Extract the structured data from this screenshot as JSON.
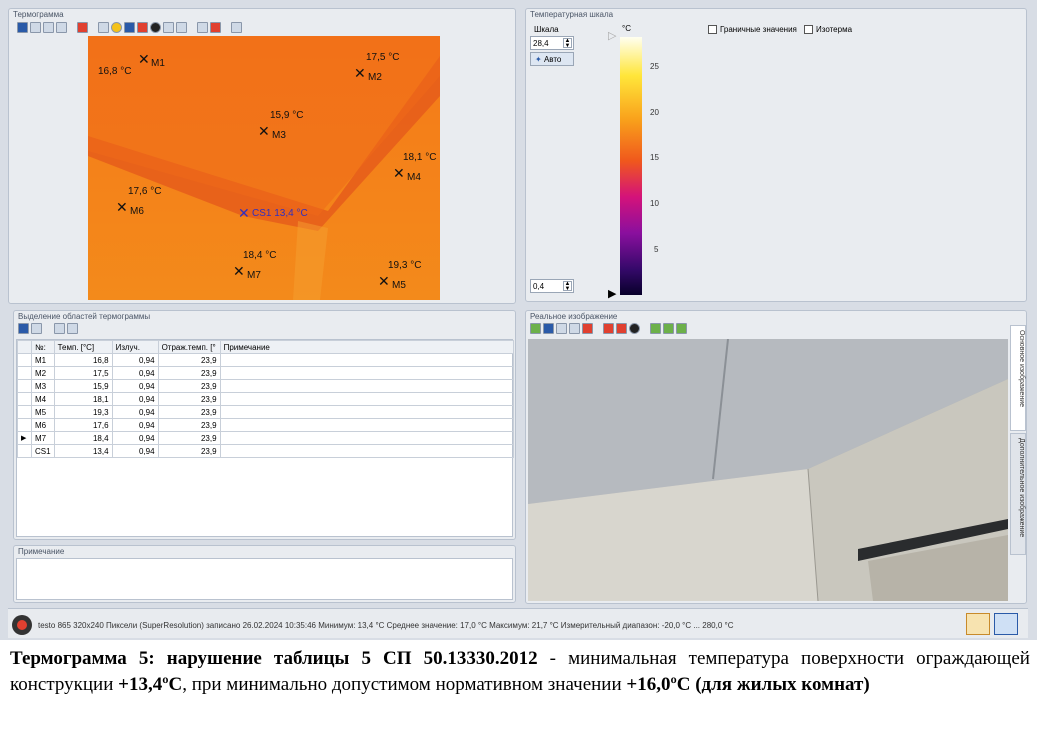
{
  "thermogram": {
    "title": "Термограмма",
    "markers": [
      {
        "id": "M1",
        "temp": "16,8 °C"
      },
      {
        "id": "M2",
        "temp": "17,5 °C"
      },
      {
        "id": "M3",
        "temp": "15,9 °C"
      },
      {
        "id": "M4",
        "temp": "18,1 °C"
      },
      {
        "id": "M5",
        "temp": "19,3 °C"
      },
      {
        "id": "M6",
        "temp": "17,6 °C"
      },
      {
        "id": "M7",
        "temp": "18,4 °C"
      },
      {
        "id": "CS1",
        "temp": "CS1 13,4 °C"
      }
    ]
  },
  "scale": {
    "title": "Температурная шкала",
    "label": "Шкала",
    "max": "28,4",
    "min": "0,4",
    "auto": "Авто",
    "unit": "°C",
    "ticks": [
      "25",
      "20",
      "15",
      "10",
      "5"
    ],
    "limits_label": "Граничные значения",
    "isotherm_label": "Изотерма"
  },
  "regions": {
    "title": "Выделение областей термограммы",
    "headers": [
      "№:",
      "Темп. [°C]",
      "Излуч.",
      "Отраж.темп. [°",
      "Примечание"
    ],
    "rows": [
      [
        "M1",
        "16,8",
        "0,94",
        "23,9",
        ""
      ],
      [
        "M2",
        "17,5",
        "0,94",
        "23,9",
        ""
      ],
      [
        "M3",
        "15,9",
        "0,94",
        "23,9",
        ""
      ],
      [
        "M4",
        "18,1",
        "0,94",
        "23,9",
        ""
      ],
      [
        "M5",
        "19,3",
        "0,94",
        "23,9",
        ""
      ],
      [
        "M6",
        "17,6",
        "0,94",
        "23,9",
        ""
      ],
      [
        "M7",
        "18,4",
        "0,94",
        "23,9",
        ""
      ],
      [
        "CS1",
        "13,4",
        "0,94",
        "23,9",
        ""
      ]
    ]
  },
  "note": {
    "title": "Примечание"
  },
  "real_image": {
    "title": "Реальное изображение",
    "tab_main": "Основное изображение",
    "tab_extra": "Дополнительное изображение"
  },
  "status": {
    "text": "testo 865 320x240 Пиксели (SuperResolution) записано 26.02.2024 10:35:46  Минимум: 13,4 °C  Среднее значение: 17,0 °C  Максимум: 21,7 °C  Измерительный диапазон: -20,0 °C ... 280,0 °C"
  },
  "caption": {
    "bold1": "Термограмма  5: нарушение таблицы 5 СП 50.13330.2012",
    "text1": " - минимальная температура поверхности ограждающей конструкции ",
    "bold2": "+13,4ºC",
    "text2": ", при минимально допустимом нормативном значении ",
    "bold3": "+16,0ºC (для жилых комнат)"
  },
  "colors": {
    "thermo_orange": "#f28218",
    "thermo_dark": "#d94a1c",
    "accent": "#2a5aa8"
  }
}
